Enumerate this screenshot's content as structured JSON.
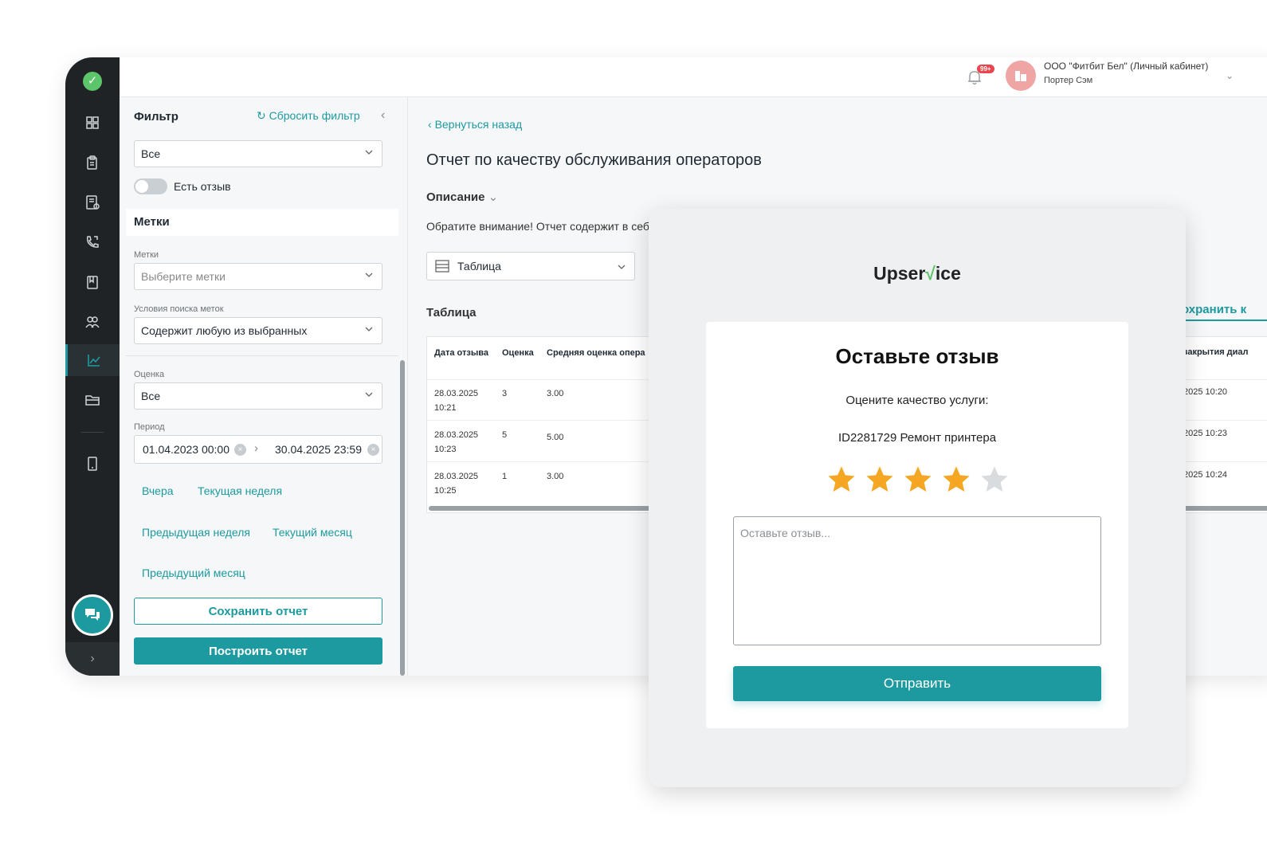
{
  "header": {
    "notifications_badge": "99+",
    "company": "ООО \"Фитбит Бел\" (Личный кабинет)",
    "user": "Портер Сэм"
  },
  "sidebar": {
    "items": [
      {
        "icon": "dashboard-icon"
      },
      {
        "icon": "clipboard-icon"
      },
      {
        "icon": "document-list-icon"
      },
      {
        "icon": "phone-icon"
      },
      {
        "icon": "bookmark-icon"
      },
      {
        "icon": "users-icon"
      },
      {
        "icon": "chart-icon",
        "active": true
      },
      {
        "icon": "folder-icon"
      },
      {
        "icon": "tablet-icon"
      }
    ]
  },
  "filter": {
    "title": "Фильтр",
    "reset_label": "Сбросить фильтр",
    "top_select_value": "Все",
    "has_review_label": "Есть отзыв",
    "has_review_on": false,
    "tags_section": "Метки",
    "tags_label": "Метки",
    "tags_placeholder": "Выберите метки",
    "tags_condition_label": "Условия поиска меток",
    "tags_condition_value": "Содержит любую из выбранных",
    "rating_label": "Оценка",
    "rating_value": "Все",
    "period_label": "Период",
    "period_from": "01.04.2023 00:00",
    "period_to": "30.04.2025 23:59",
    "quick": {
      "yesterday": "Вчера",
      "current_week": "Текущая неделя",
      "previous_week": "Предыдущая неделя",
      "current_month": "Текущий месяц",
      "previous_month": "Предыдущий месяц"
    },
    "save_report": "Сохранить отчет",
    "build_report": "Построить отчет"
  },
  "main": {
    "back_label": "Вернуться назад",
    "title": "Отчет по качеству обслуживания операторов",
    "description_label": "Описание",
    "notice": "Обратите внимание! Отчет содержит в себ",
    "view_select": "Таблица",
    "table_title": "Таблица",
    "save_partial": "охранить к",
    "columns": [
      "Дата отзыва",
      "Оценка",
      "Средняя оценка опера"
    ],
    "right_column": "закрытия диал",
    "rows": [
      {
        "date": "28.03.2025",
        "time": "10:21",
        "rating": "3",
        "avg": "3.00",
        "closed": "2025 10:20"
      },
      {
        "date": "28.03.2025",
        "time": "10:23",
        "rating": "5",
        "avg": "5.00",
        "closed": "2025 10:23"
      },
      {
        "date": "28.03.2025",
        "time": "10:25",
        "rating": "1",
        "avg": "3.00",
        "closed": "2025 10:24"
      }
    ]
  },
  "modal": {
    "brand_left": "Upser",
    "brand_mark": "√",
    "brand_right": "ice",
    "heading": "Оставьте отзыв",
    "question": "Оцените качество услуги:",
    "service": "ID2281729 Ремонт принтера",
    "rating": 4,
    "rating_max": 5,
    "textarea_placeholder": "Оставьте отзыв...",
    "submit_label": "Отправить",
    "colors": {
      "accent": "#1c9aa0",
      "star_on": "#f5a623",
      "star_off": "#d9dcdf"
    }
  }
}
